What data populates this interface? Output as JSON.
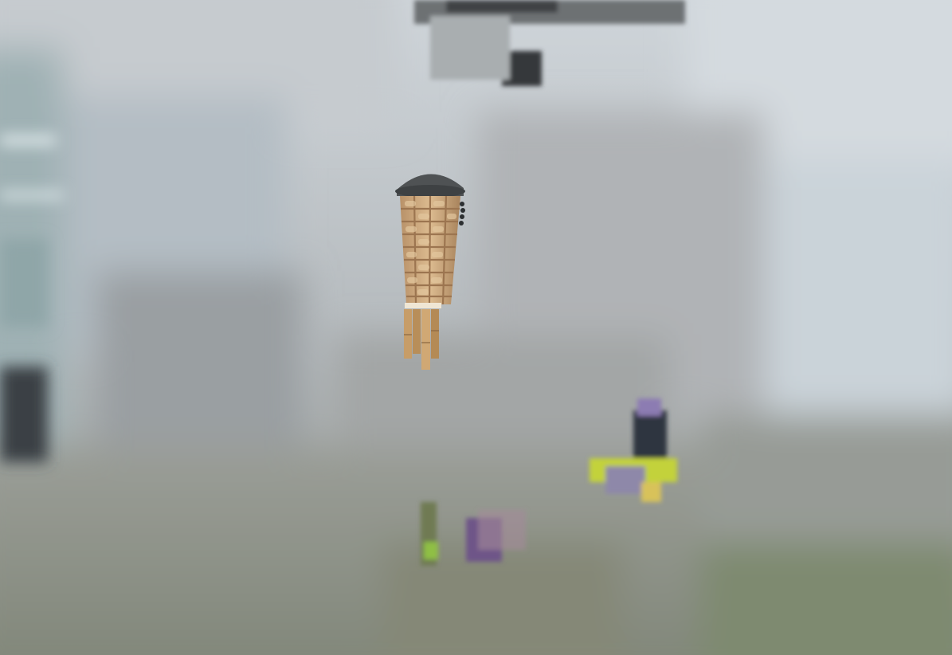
{
  "scene": {
    "subject": "woven-basket-with-bamboo-tubes",
    "colors": {
      "background_light": "#c9cfd4",
      "background_mid": "#aeb3b5",
      "background_ground": "#8d9289",
      "window_left": "#9db3b8",
      "window_right": "#d6dde2",
      "ceiling_dark": "#3f4244",
      "cap": "#4f5254",
      "weave_light": "#d8b488",
      "weave_dark": "#9c7550",
      "bamboo": "#c79d68",
      "flower_purple": "#6e5588",
      "flower_yellow": "#c3d23a",
      "foliage": "#6f7a52"
    }
  }
}
